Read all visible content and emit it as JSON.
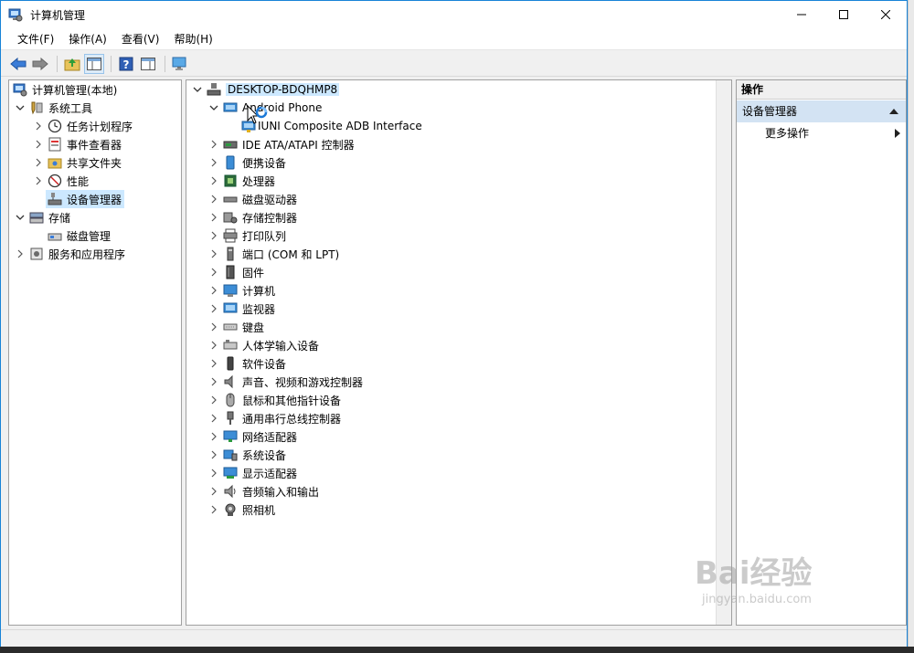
{
  "window": {
    "title": "计算机管理"
  },
  "menu": [
    "文件(F)",
    "操作(A)",
    "查看(V)",
    "帮助(H)"
  ],
  "toolbar_icons": [
    "back-arrow-icon",
    "forward-arrow-icon",
    "up-folder-icon",
    "show-hide-tree-icon",
    "help-icon",
    "properties-icon",
    "monitor-icon"
  ],
  "left_tree": {
    "root": "计算机管理(本地)",
    "system_tools": "系统工具",
    "task_scheduler": "任务计划程序",
    "event_viewer": "事件查看器",
    "shared_folders": "共享文件夹",
    "performance": "性能",
    "device_manager": "设备管理器",
    "storage": "存储",
    "disk_management": "磁盘管理",
    "services_apps": "服务和应用程序"
  },
  "device_tree": {
    "computer": "DESKTOP-BDQHMP8",
    "android_phone": "Android Phone",
    "adb_interface": "IUNI Composite ADB Interface",
    "categories": [
      "IDE ATA/ATAPI 控制器",
      "便携设备",
      "处理器",
      "磁盘驱动器",
      "存储控制器",
      "打印队列",
      "端口 (COM 和 LPT)",
      "固件",
      "计算机",
      "监视器",
      "键盘",
      "人体学输入设备",
      "软件设备",
      "声音、视频和游戏控制器",
      "鼠标和其他指针设备",
      "通用串行总线控制器",
      "网络适配器",
      "系统设备",
      "显示适配器",
      "音频输入和输出",
      "照相机"
    ]
  },
  "actions": {
    "header": "操作",
    "section": "设备管理器",
    "more": "更多操作"
  },
  "watermark": {
    "brand": "Bai经验",
    "url": "jingyan.baidu.com"
  },
  "colors": {
    "selection": "#cce8ff",
    "action_section": "#d3e3f3",
    "window_border": "#1883d7"
  }
}
